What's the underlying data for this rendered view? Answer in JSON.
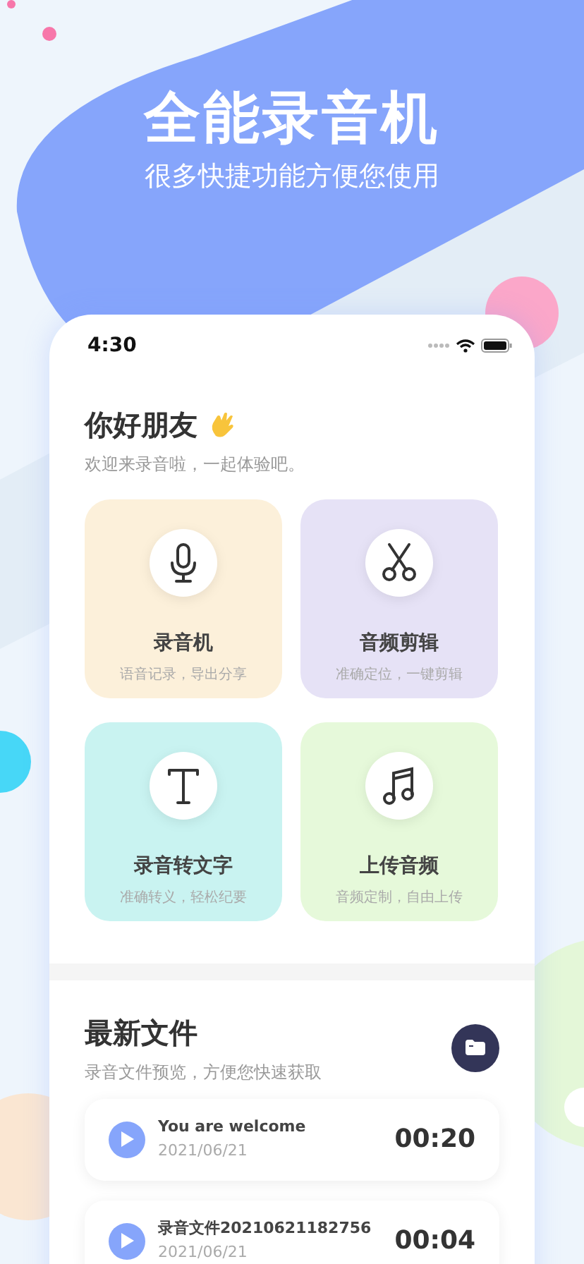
{
  "hero": {
    "title": "全能录音机",
    "subtitle": "很多快捷功能方便您使用"
  },
  "status_bar": {
    "time": "4:30"
  },
  "greeting": {
    "title": "你好朋友",
    "subtitle": "欢迎来录音啦，一起体验吧。"
  },
  "features": [
    {
      "kind": "mic",
      "title": "录音机",
      "subtitle": "语音记录，导出分享",
      "color": "#fcf0da"
    },
    {
      "kind": "scissors",
      "title": "音频剪辑",
      "subtitle": "准确定位，一键剪辑",
      "color": "#e6e2f6"
    },
    {
      "kind": "text",
      "title": "录音转文字",
      "subtitle": "准确转义，轻松纪要",
      "color": "#c9f3f1"
    },
    {
      "kind": "music",
      "title": "上传音频",
      "subtitle": "音频定制，自由上传",
      "color": "#e6f9da"
    }
  ],
  "recent": {
    "title": "最新文件",
    "subtitle": "录音文件预览，方便您快速获取"
  },
  "files": [
    {
      "name": "You are welcome",
      "date": "2021/06/21",
      "duration": "00:20"
    },
    {
      "name": "录音文件20210621182756",
      "date": "2021/06/21",
      "duration": "00:04"
    }
  ]
}
